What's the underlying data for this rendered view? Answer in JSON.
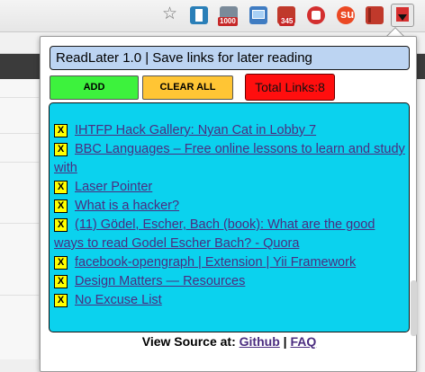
{
  "browser": {
    "star_glyph": "☆",
    "extensions": [
      {
        "name": "bookmark-ext",
        "color": "#2a7fb8"
      },
      {
        "name": "counter-ext",
        "color": "#7a8a99",
        "badge": "1000",
        "badge_color": "#c62828"
      },
      {
        "name": "photo-ext",
        "color": "#3f7cc2"
      },
      {
        "name": "speed-ext",
        "color": "#c0392b",
        "badge": "345",
        "badge_color": "#c62828"
      },
      {
        "name": "stop-ext",
        "color": "#d32f2f"
      },
      {
        "name": "stumble-ext",
        "color": "#eb4924"
      },
      {
        "name": "book-ext",
        "color": "#c0392b"
      },
      {
        "name": "readlater-ext",
        "color": "#d62f2f"
      }
    ]
  },
  "popup": {
    "title": "ReadLater 1.0 | Save links for later reading",
    "add_label": "ADD",
    "clear_label": "CLEAR ALL",
    "total_label": "Total Links:8",
    "remove_label": "X",
    "links": [
      "IHTFP Hack Gallery: Nyan Cat in Lobby 7",
      "BBC Languages – Free online lessons to learn and study with",
      "Laser Pointer",
      "What is a hacker?",
      "(11) Gödel, Escher, Bach (book): What are the good ways to read Godel Escher Bach? - Quora",
      "facebook-opengraph | Extension | Yii Framework",
      "Design Matters — Resources",
      "No Excuse List"
    ],
    "footer": {
      "prefix": "View Source at:",
      "github": "Github",
      "separator": "|",
      "faq": "FAQ"
    }
  },
  "colors": {
    "header_bg": "#bcd4f2",
    "add_bg": "#3df23d",
    "clear_bg": "#ffc534",
    "total_bg": "#ff0e0e",
    "list_bg": "#0bd2ee",
    "remove_bg": "#ffff00",
    "link": "#4b2d80"
  }
}
